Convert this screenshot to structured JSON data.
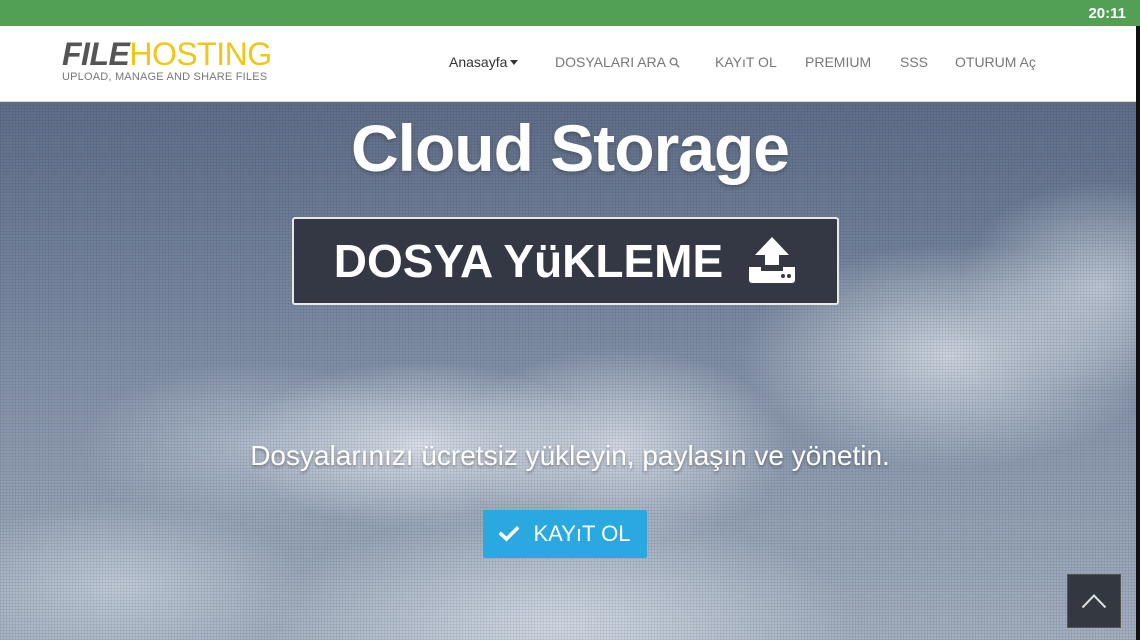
{
  "status_bar": {
    "time": "20:11"
  },
  "logo": {
    "part1": "FILE",
    "part2": "HOSTING",
    "tagline": "UPLOAD, MANAGE AND SHARE FILES"
  },
  "nav": {
    "home": "Anasayfa",
    "search_files": "DOSYALARI ARA",
    "register": "KAYıT OL",
    "premium": "PREMIUM",
    "faq": "SSS",
    "login": "OTURUM Aç"
  },
  "hero": {
    "headline": "Cloud Storage",
    "upload_label": "DOSYA YüKLEME",
    "subtitle": "Dosyalarınızı ücretsiz yükleyin, paylaşın ve yönetin.",
    "register_label": "KAYıT OL"
  },
  "colors": {
    "status_bar": "#52a056",
    "upload_button": "#333844",
    "register_button": "#2aa9e0",
    "logo_accent": "#f0c619"
  },
  "icons": {
    "upload": "upload-icon",
    "check": "check-icon",
    "search": "search-icon",
    "scroll_top": "chevron-up-icon"
  }
}
